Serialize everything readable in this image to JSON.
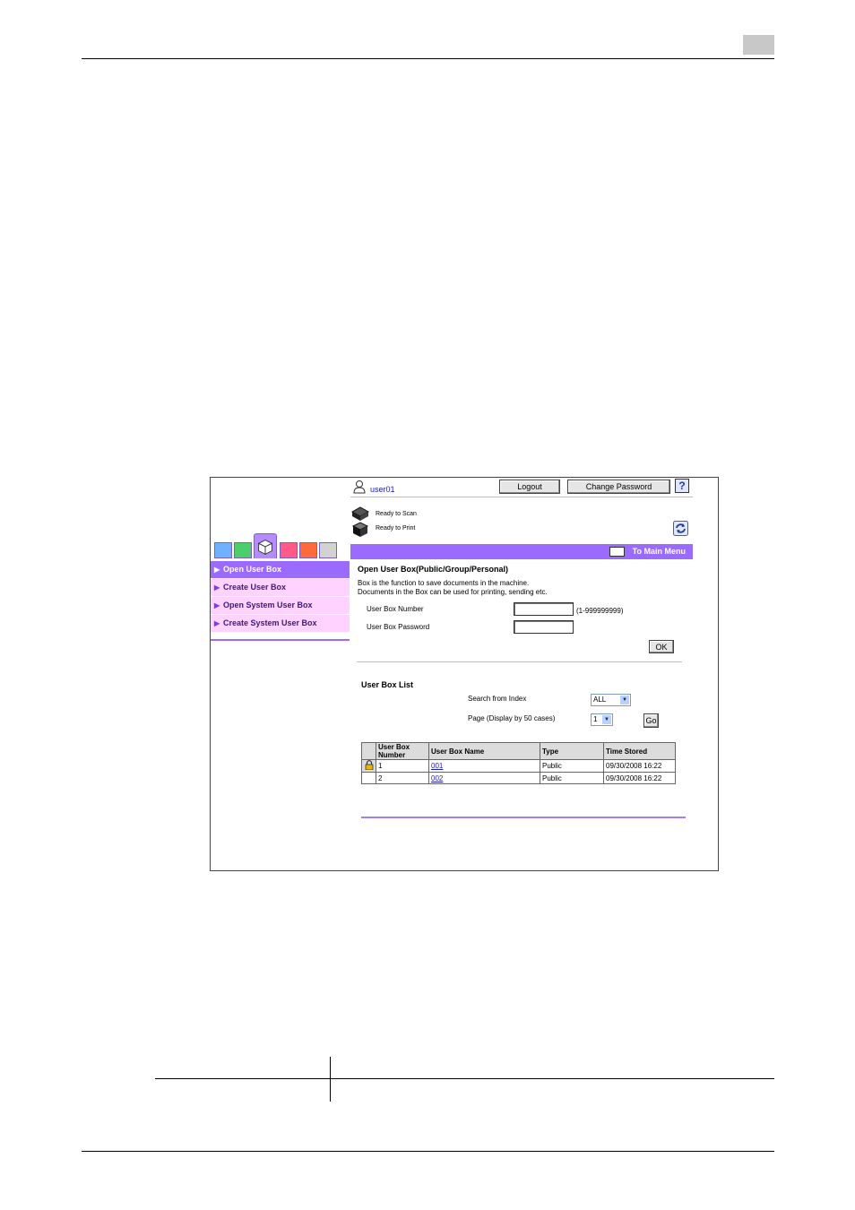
{
  "header": {
    "user": "user01",
    "logout": "Logout",
    "change_password": "Change Password",
    "help_icon": "?"
  },
  "status": {
    "scan": "Ready to Scan",
    "print": "Ready to Print"
  },
  "menu_bar": {
    "to_main_menu": "To Main Menu"
  },
  "sidebar": {
    "items": [
      {
        "label": "Open User Box",
        "active": true
      },
      {
        "label": "Create User Box",
        "active": false
      },
      {
        "label": "Open System User Box",
        "active": false
      },
      {
        "label": "Create System User Box",
        "active": false
      }
    ]
  },
  "open_box": {
    "title": "Open User Box(Public/Group/Personal)",
    "desc1": "Box is the function to save documents in the machine.",
    "desc2": "Documents in the Box can be used for printing, sending etc.",
    "number_label": "User Box Number",
    "number_value": "",
    "number_hint": "(1-999999999)",
    "password_label": "User Box Password",
    "password_value": "",
    "ok": "OK"
  },
  "box_list": {
    "title": "User Box List",
    "search_label": "Search from Index",
    "search_value": "ALL",
    "page_label": "Page (Display by 50 cases)",
    "page_value": "1",
    "go": "Go",
    "columns": {
      "number": "User Box Number",
      "name": "User Box Name",
      "type": "Type",
      "time": "Time Stored"
    },
    "rows": [
      {
        "locked": true,
        "number": "1",
        "name": "001",
        "type": "Public",
        "time": "09/30/2008 16:22"
      },
      {
        "locked": false,
        "number": "2",
        "name": "002",
        "type": "Public",
        "time": "09/30/2008 16:22"
      }
    ]
  }
}
